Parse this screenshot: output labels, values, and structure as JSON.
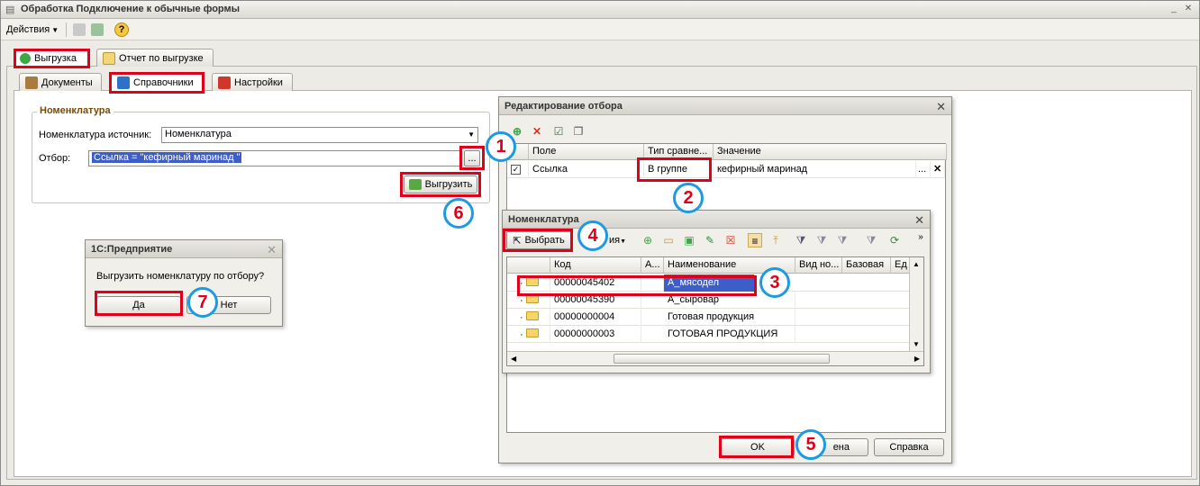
{
  "window": {
    "title": "Обработка  Подключение к обычные формы"
  },
  "menubar": {
    "actions": "Действия",
    "help": "?"
  },
  "top_tabs": [
    {
      "label": "Выгрузка",
      "active": true
    },
    {
      "label": "Отчет по выгрузке",
      "active": false
    }
  ],
  "sub_tabs": [
    {
      "label": "Документы",
      "active": false
    },
    {
      "label": "Справочники",
      "active": true
    },
    {
      "label": "Настройки",
      "active": false
    }
  ],
  "nomenclature_group": {
    "legend": "Номенклатура",
    "source_label": "Номенклатура источник:",
    "source_value": "Номенклатура",
    "filter_label": "Отбор:",
    "filter_value": "Ссылка = \"кефирный маринад \"",
    "ellipsis": "...",
    "export_button": "Выгрузить"
  },
  "confirm_dialog": {
    "title": "1С:Предприятие",
    "message": "Выгрузить номенклатуру по отбору?",
    "yes": "Да",
    "no": "Нет"
  },
  "filter_dialog": {
    "title": "Редактирование отбора",
    "columns": [
      "Поле",
      "Тип сравне...",
      "Значение"
    ],
    "row": {
      "checked": true,
      "field": "Ссылка",
      "compare": "В группе",
      "value": "кефирный маринад"
    },
    "ellipsis": "...",
    "ok": "OK",
    "cancel_partial": "ена",
    "help": "Справка"
  },
  "nomen_dialog": {
    "title": "Номенклатура",
    "select_button": "Выбрать",
    "actions_partial": "ия",
    "columns": [
      "Код",
      "А...",
      "Наименование",
      "Вид но...",
      "Базовая",
      "Ед"
    ],
    "rows": [
      {
        "code": "00000045402",
        "name": "А_мясодел",
        "selected": true
      },
      {
        "code": "00000045390",
        "name": "А_сыровар",
        "selected": false
      },
      {
        "code": "00000000004",
        "name": "Готовая продукция",
        "selected": false
      },
      {
        "code": "00000000003",
        "name": "ГОТОВАЯ ПРОДУКЦИЯ",
        "selected": false
      }
    ]
  },
  "step_markers": [
    "1",
    "2",
    "3",
    "4",
    "5",
    "6",
    "7"
  ],
  "colors": {
    "highlight_red": "#e0001a",
    "marker_blue": "#1f9ae0",
    "selection": "#3d5ec8"
  }
}
